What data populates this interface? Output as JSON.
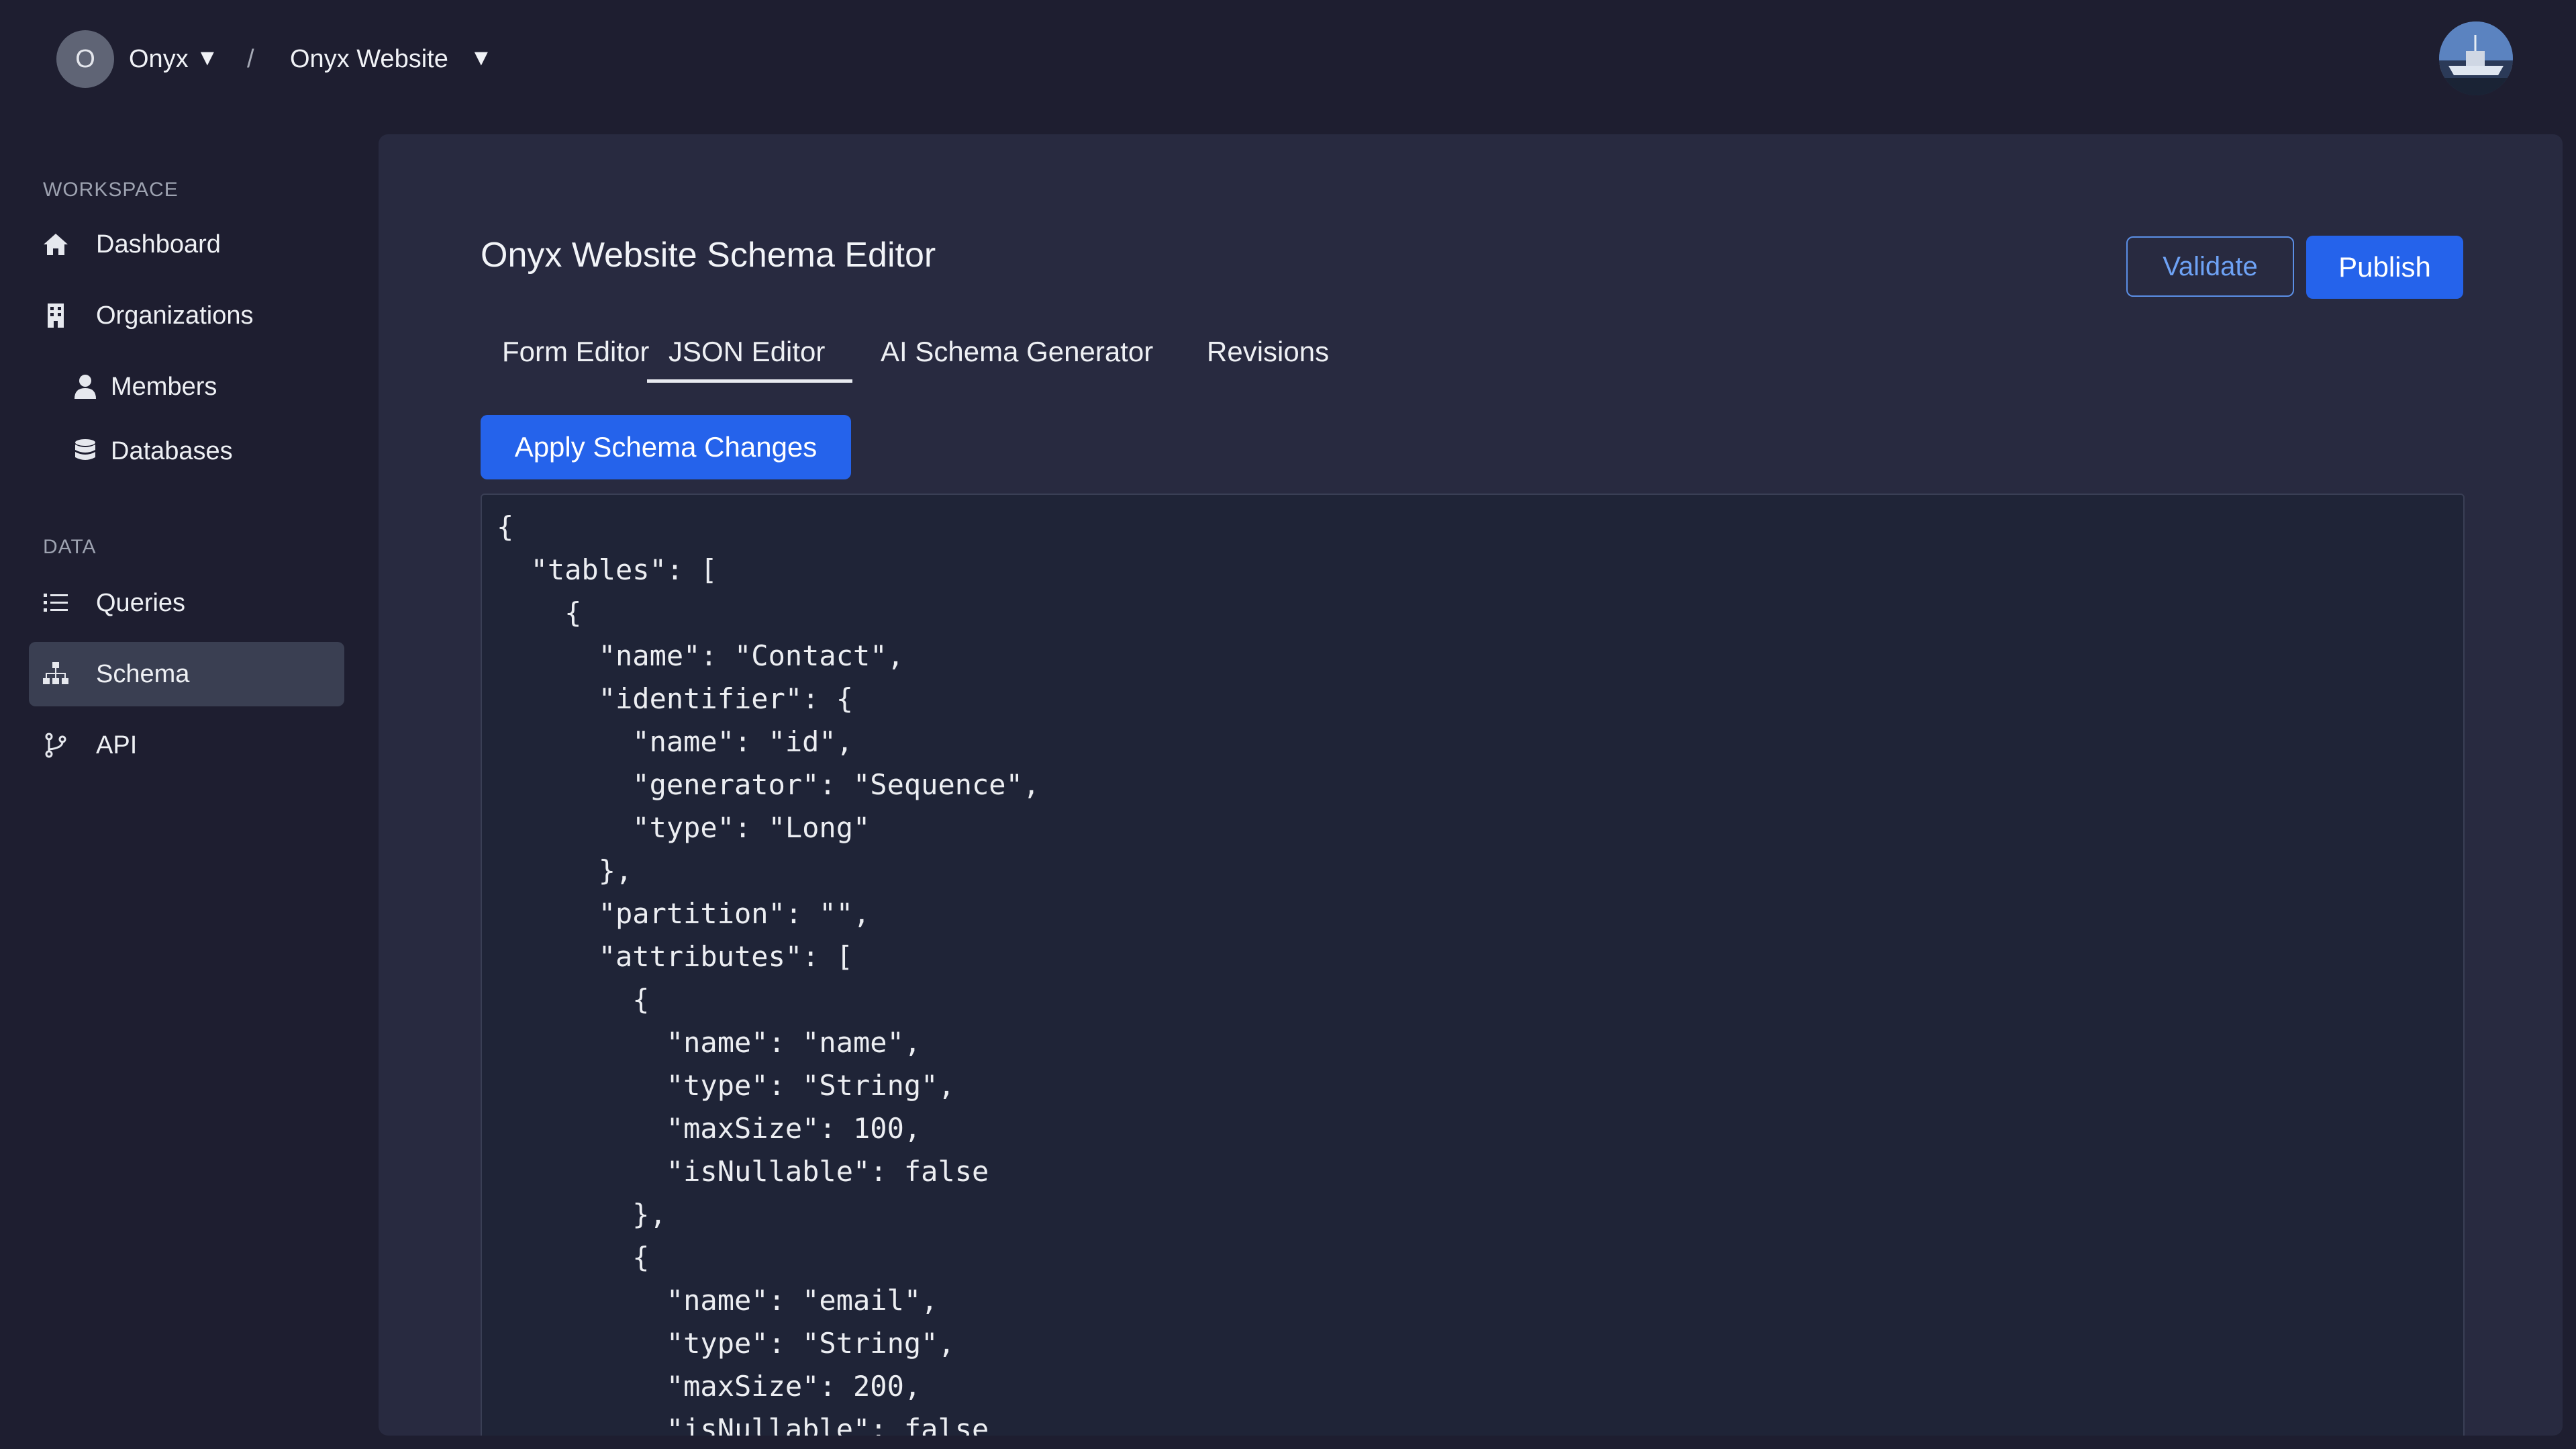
{
  "topbar": {
    "org_initial": "O",
    "org_name": "Onyx",
    "caret": "▼",
    "separator": "/",
    "project_name": "Onyx Website"
  },
  "sidebar": {
    "workspace_label": "WORKSPACE",
    "data_label": "DATA",
    "items": [
      {
        "label": "Dashboard",
        "icon": "home-icon"
      },
      {
        "label": "Organizations",
        "icon": "building-icon"
      },
      {
        "label": "Members",
        "icon": "user-icon"
      },
      {
        "label": "Databases",
        "icon": "database-icon"
      },
      {
        "label": "Queries",
        "icon": "list-icon"
      },
      {
        "label": "Schema",
        "icon": "sitemap-icon",
        "active": true
      },
      {
        "label": "API",
        "icon": "code-branch-icon"
      }
    ]
  },
  "main": {
    "title": "Onyx Website Schema Editor",
    "validate_label": "Validate",
    "publish_label": "Publish",
    "tabs": [
      {
        "label": "Form Editor",
        "active": false
      },
      {
        "label": "JSON Editor",
        "active": true
      },
      {
        "label": "AI Schema Generator",
        "active": false
      },
      {
        "label": "Revisions",
        "active": false
      }
    ],
    "apply_label": "Apply Schema Changes",
    "editor_content": "{\n  \"tables\": [\n    {\n      \"name\": \"Contact\",\n      \"identifier\": {\n        \"name\": \"id\",\n        \"generator\": \"Sequence\",\n        \"type\": \"Long\"\n      },\n      \"partition\": \"\",\n      \"attributes\": [\n        {\n          \"name\": \"name\",\n          \"type\": \"String\",\n          \"maxSize\": 100,\n          \"isNullable\": false\n        },\n        {\n          \"name\": \"email\",\n          \"type\": \"String\",\n          \"maxSize\": 200,\n          \"isNullable\": false"
  },
  "colors": {
    "background": "#1e1e30",
    "panel": "#282a40",
    "editor": "#1f2437",
    "accent": "#2563eb",
    "active_nav": "#3a3f52"
  }
}
